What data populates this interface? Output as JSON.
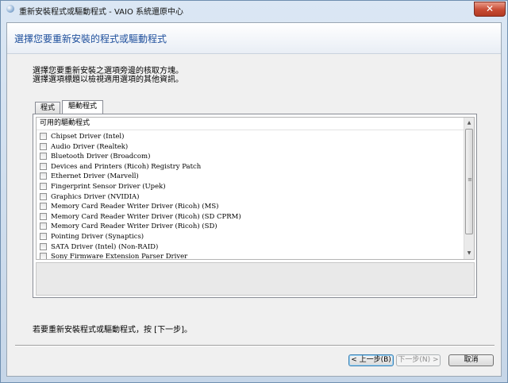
{
  "window": {
    "title": "重新安裝程式或驅動程式 - VAIO 系統還原中心",
    "close_label": "✕"
  },
  "header": {
    "title": "選擇您要重新安裝的程式或驅動程式"
  },
  "instructions": {
    "line1": "選擇您要重新安裝之選項旁邊的核取方塊。",
    "line2": "選擇選項標題以檢視適用選項的其他資訊。"
  },
  "tabs": [
    {
      "label": "程式",
      "active": false
    },
    {
      "label": "驅動程式",
      "active": true
    }
  ],
  "list": {
    "header": "可用的驅動程式",
    "items": [
      {
        "label": "Chipset Driver (Intel)",
        "checked": false
      },
      {
        "label": "Audio Driver (Realtek)",
        "checked": false
      },
      {
        "label": "Bluetooth Driver (Broadcom)",
        "checked": false
      },
      {
        "label": "Devices and Printers (Ricoh) Registry Patch",
        "checked": false
      },
      {
        "label": "Ethernet Driver (Marvell)",
        "checked": false
      },
      {
        "label": "Fingerprint Sensor Driver (Upek)",
        "checked": false
      },
      {
        "label": "Graphics Driver (NVIDIA)",
        "checked": false
      },
      {
        "label": "Memory Card Reader Writer Driver (Ricoh) (MS)",
        "checked": false
      },
      {
        "label": "Memory Card Reader Writer Driver (Ricoh) (SD CPRM)",
        "checked": false
      },
      {
        "label": "Memory Card Reader Writer Driver (Ricoh) (SD)",
        "checked": false
      },
      {
        "label": "Pointing Driver (Synaptics)",
        "checked": false
      },
      {
        "label": "SATA Driver (Intel) (Non-RAID)",
        "checked": false
      },
      {
        "label": "Sony Firmware Extension Parser Driver",
        "checked": false
      }
    ]
  },
  "footer": {
    "message": "若要重新安裝程式或驅動程式，按 [下一步]。",
    "back_label": "< 上一步(B)",
    "next_label": "下一步(N) >",
    "cancel_label": "取消"
  }
}
